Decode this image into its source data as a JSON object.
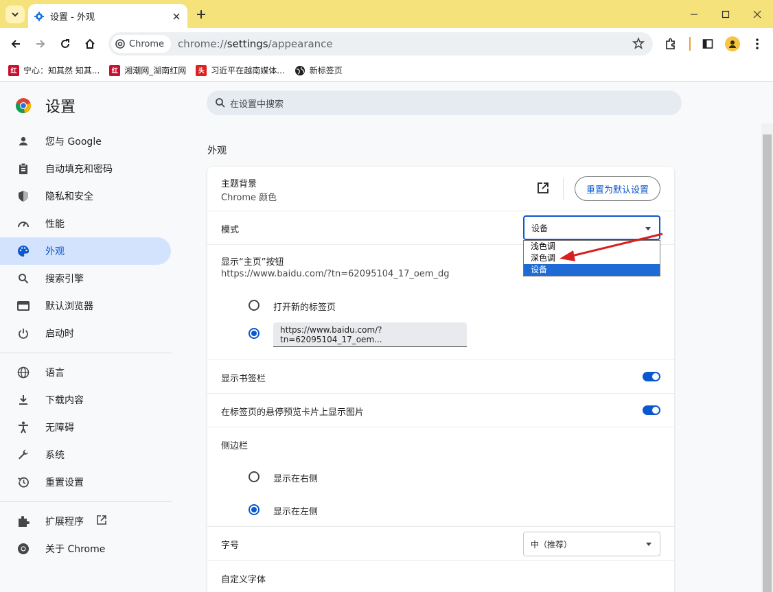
{
  "browser": {
    "tab_title": "设置 - 外观",
    "address_chip": "Chrome",
    "url_prefix": "chrome://",
    "url_main": "settings",
    "url_suffix": "/appearance",
    "accent_color": "#0b57d0",
    "titlebar_color": "#f6e27a"
  },
  "bookmarks": [
    {
      "label": "宁心：知其然 知其...",
      "icon": "site-icon"
    },
    {
      "label": "湘潮网_湖南红网",
      "icon": "site-icon"
    },
    {
      "label": "习近平在越南媒体...",
      "icon": "news-icon"
    },
    {
      "label": "新标签页",
      "icon": "globe-icon"
    }
  ],
  "settings": {
    "title": "设置",
    "search_placeholder": "在设置中搜索"
  },
  "sidebar": {
    "items": [
      {
        "label": "您与 Google",
        "icon": "person-icon"
      },
      {
        "label": "自动填充和密码",
        "icon": "clipboard-icon"
      },
      {
        "label": "隐私和安全",
        "icon": "shield-icon"
      },
      {
        "label": "性能",
        "icon": "speedometer-icon"
      },
      {
        "label": "外观",
        "icon": "palette-icon",
        "active": true
      },
      {
        "label": "搜索引擎",
        "icon": "search-icon"
      },
      {
        "label": "默认浏览器",
        "icon": "browser-icon"
      },
      {
        "label": "启动时",
        "icon": "power-icon"
      }
    ],
    "items2": [
      {
        "label": "语言",
        "icon": "globe-icon"
      },
      {
        "label": "下载内容",
        "icon": "download-icon"
      },
      {
        "label": "无障碍",
        "icon": "accessibility-icon"
      },
      {
        "label": "系统",
        "icon": "wrench-icon"
      },
      {
        "label": "重置设置",
        "icon": "history-icon"
      }
    ],
    "items3": [
      {
        "label": "扩展程序",
        "icon": "puzzle-icon"
      },
      {
        "label": "关于 Chrome",
        "icon": "chrome-icon"
      }
    ]
  },
  "appearance": {
    "section_title": "外观",
    "theme_label": "主题背景",
    "theme_value": "Chrome 颜色",
    "reset_button": "重置为默认设置",
    "mode_label": "模式",
    "mode_value": "设备",
    "mode_options": [
      "浅色调",
      "深色调",
      "设备"
    ],
    "mode_selected": "设备",
    "home_label": "显示“主页”按钮",
    "home_url": "https://www.baidu.com/?tn=62095104_17_oem_dg",
    "home_option_newtab": "打开新的标签页",
    "home_option_url_value": "https://www.baidu.com/?tn=62095104_17_oem...",
    "bookmarks_bar_label": "显示书签栏",
    "bookmarks_bar_on": true,
    "hover_preview_label": "在标签页的悬停预览卡片上显示图片",
    "hover_preview_on": true,
    "sidepanel_label": "侧边栏",
    "sidepanel_right": "显示在右侧",
    "sidepanel_left": "显示在左侧",
    "fontsize_label": "字号",
    "fontsize_value": "中（推荐）",
    "custom_font_label": "自定义字体"
  },
  "annotation": {
    "arrow_color": "#d92020"
  }
}
